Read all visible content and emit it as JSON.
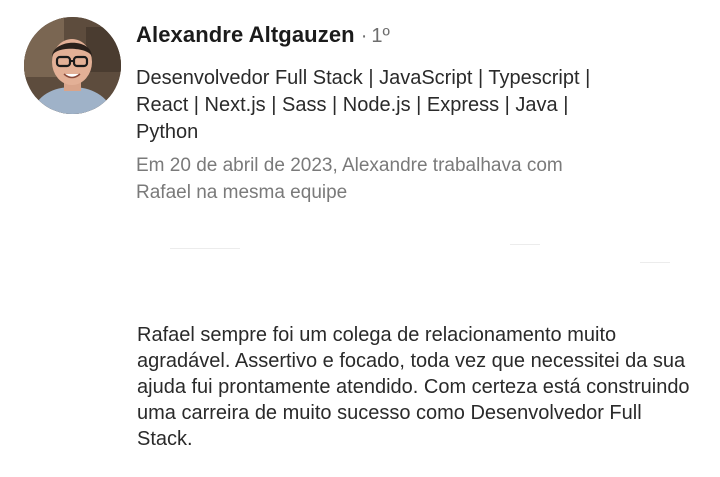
{
  "profile": {
    "name": "Alexandre Altgauzen",
    "degree_separator": "·",
    "degree": "1º",
    "headline": "Desenvolvedor Full Stack | JavaScript | Typescript | React | Next.js | Sass | Node.js | Express | Java | Python",
    "context": "Em 20 de abril de 2023, Alexandre trabalhava com Rafael na mesma equipe",
    "avatar_icon": "profile-photo"
  },
  "recommendation": {
    "text": "Rafael sempre foi um colega de relacionamento muito agradável. Assertivo e focado, toda vez que necessitei da sua ajuda fui prontamente atendido. Com certeza está construindo uma carreira de muito sucesso como Desenvolvedor Full Stack."
  },
  "colors": {
    "name": "#1b1b1b",
    "meta": "#7a7a7a",
    "body": "#2a2a2a",
    "background": "#ffffff"
  }
}
